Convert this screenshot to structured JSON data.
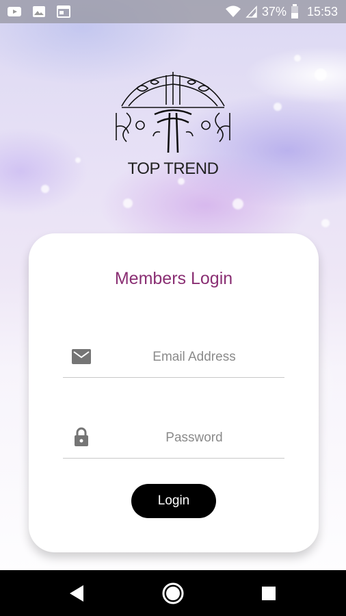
{
  "status_bar": {
    "battery_percent": "37%",
    "time": "15:53",
    "icons": [
      "youtube-icon",
      "image-icon",
      "calendar-icon",
      "wifi-icon",
      "signal-icon",
      "battery-icon"
    ]
  },
  "logo": {
    "brand_name": "TOP TREND"
  },
  "login_card": {
    "title": "Members Login",
    "email_placeholder": "Email Address",
    "email_value": "",
    "password_placeholder": "Password",
    "password_value": "",
    "login_label": "Login"
  },
  "nav_bar": {
    "buttons": [
      "back-icon",
      "home-icon",
      "recents-icon"
    ]
  },
  "colors": {
    "title": "#8a2f73",
    "button_bg": "#000000",
    "icon_gray": "#757575"
  }
}
